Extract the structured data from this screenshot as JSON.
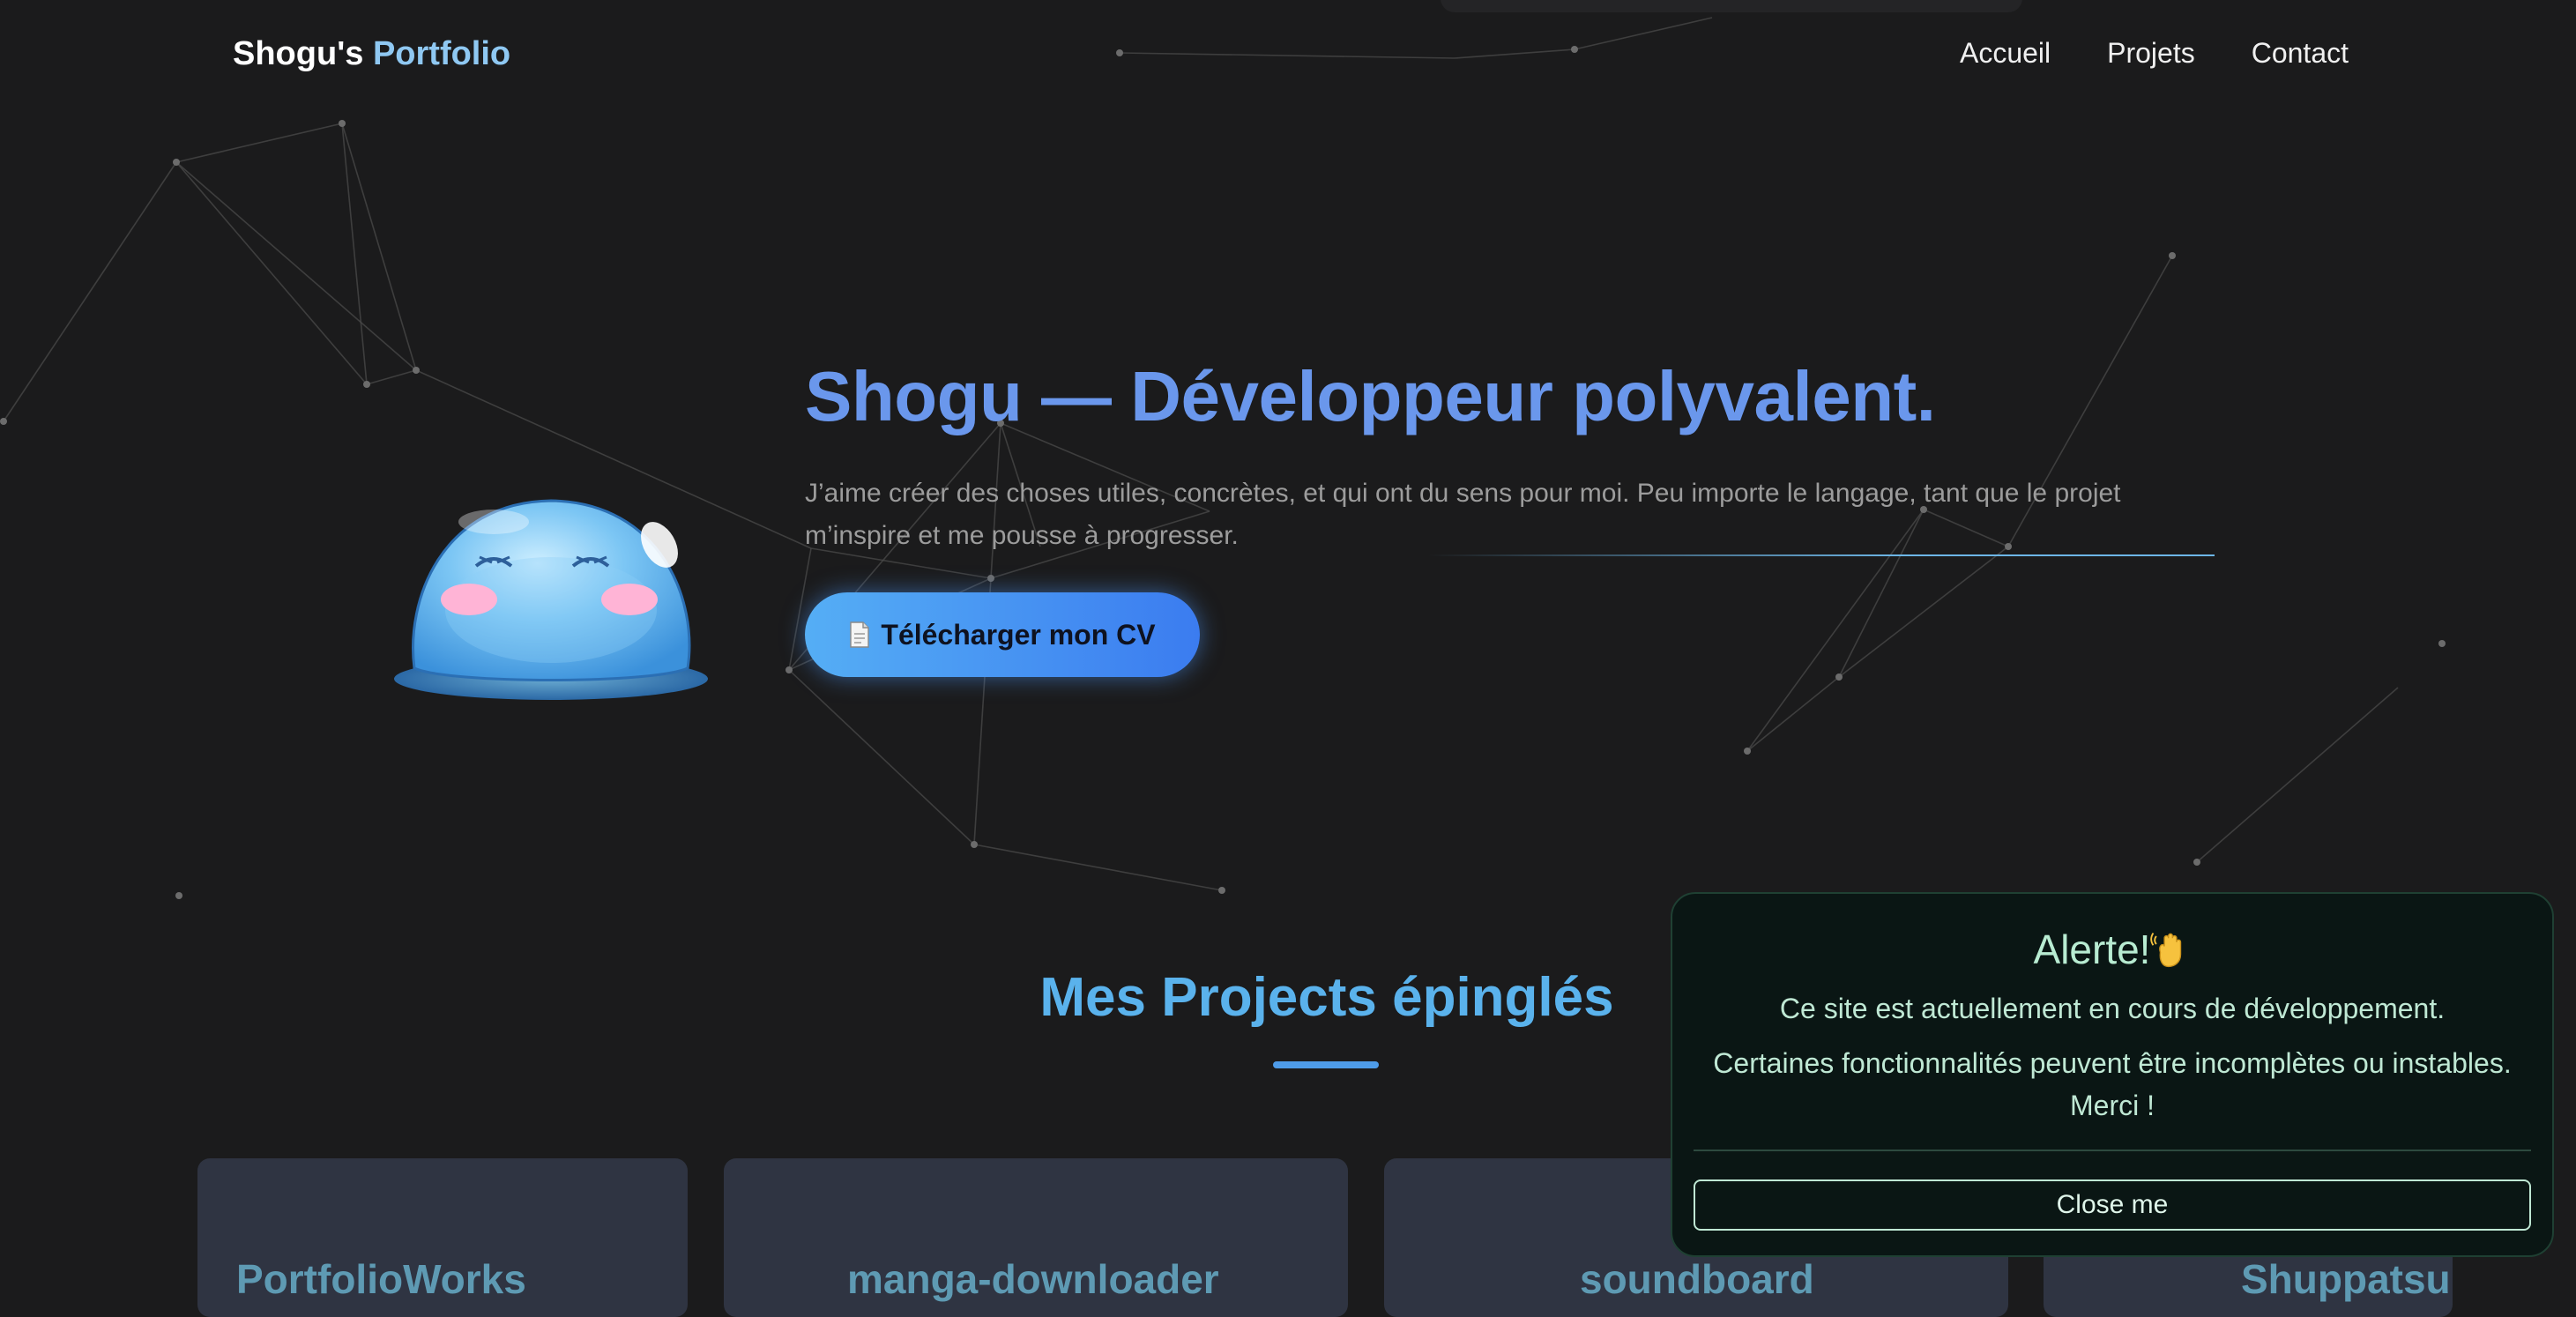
{
  "header": {
    "brand_name": "Shogu's",
    "brand_suffix": "Portfolio",
    "nav": [
      "Accueil",
      "Projets",
      "Contact"
    ]
  },
  "hero": {
    "title": "Shogu — Développeur polyvalent.",
    "description": "J’aime créer des choses utiles, concrètes, et qui ont du sens pour moi. Peu importe le langage, tant que le projet m’inspire et me pousse à progresser.",
    "cv_button": "Télécharger mon CV",
    "cv_icon": "document-icon"
  },
  "projects": {
    "heading": "Mes Projects épinglés",
    "cards": [
      "PortfolioWorks",
      "manga-downloader",
      "soundboard",
      "Shuppatsu"
    ]
  },
  "alert": {
    "title": "Alerte!",
    "title_icon": "waving-hand-icon",
    "line1": "Ce site est actuellement en cours de développement.",
    "line2": "Certaines fonctionnalités peuvent être incomplètes ou instables. Merci !",
    "close_label": "Close me"
  },
  "colors": {
    "background": "#1b1b1c",
    "accent_blue": "#6a97ec",
    "section_title": "#5ab2ec",
    "alert_bg": "#0a1614",
    "alert_text": "#bfe8d4",
    "card_bg": "#2f3442"
  }
}
